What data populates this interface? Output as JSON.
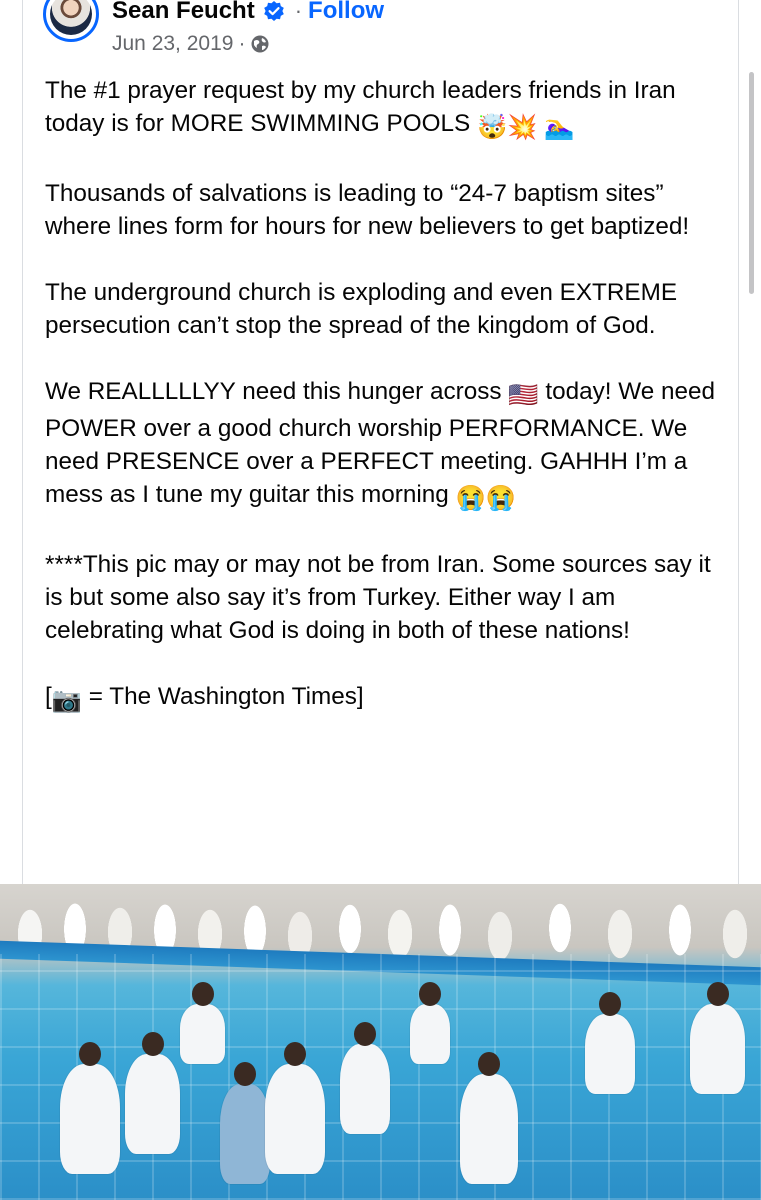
{
  "post": {
    "author": "Sean Feucht",
    "separator": "·",
    "follow_label": "Follow",
    "date": "Jun 23, 2019",
    "date_separator": "·",
    "icons": {
      "verified": "verified-badge-icon",
      "audience": "globe-icon"
    },
    "colors": {
      "accent": "#0866ff",
      "secondary_text": "#65676b",
      "text": "#050505"
    },
    "paragraphs": {
      "p1_text": "The #1 prayer request by my church leaders friends in Iran today is for MORE SWIMMING POOLS",
      "p1_emojis": "🤯💥 🏊‍♀️",
      "p2": "Thousands of salvations is leading to “24-7 baptism sites” where lines form for hours for new believers to get baptized!",
      "p3": "The underground church is exploding and even EXTREME persecution can’t stop the spread of the kingdom of God.",
      "p4_before": "We REALLLLLYY need this hunger across",
      "p4_flag": "🇺🇸",
      "p4_after": "today! We need POWER over a good church worship PERFORMANCE. We need PRESENCE over a PERFECT meeting. GAHHH I’m a mess as I tune my guitar this morning",
      "p4_emojis": "😭😭",
      "p5": "****This pic may or may not be from Iran. Some sources say it is but some also say it’s from Turkey. Either way I am celebrating what God is doing in both of these nations!",
      "p6_open": "[",
      "p6_camera": "📷",
      "p6_rest": "= The Washington Times]"
    }
  }
}
